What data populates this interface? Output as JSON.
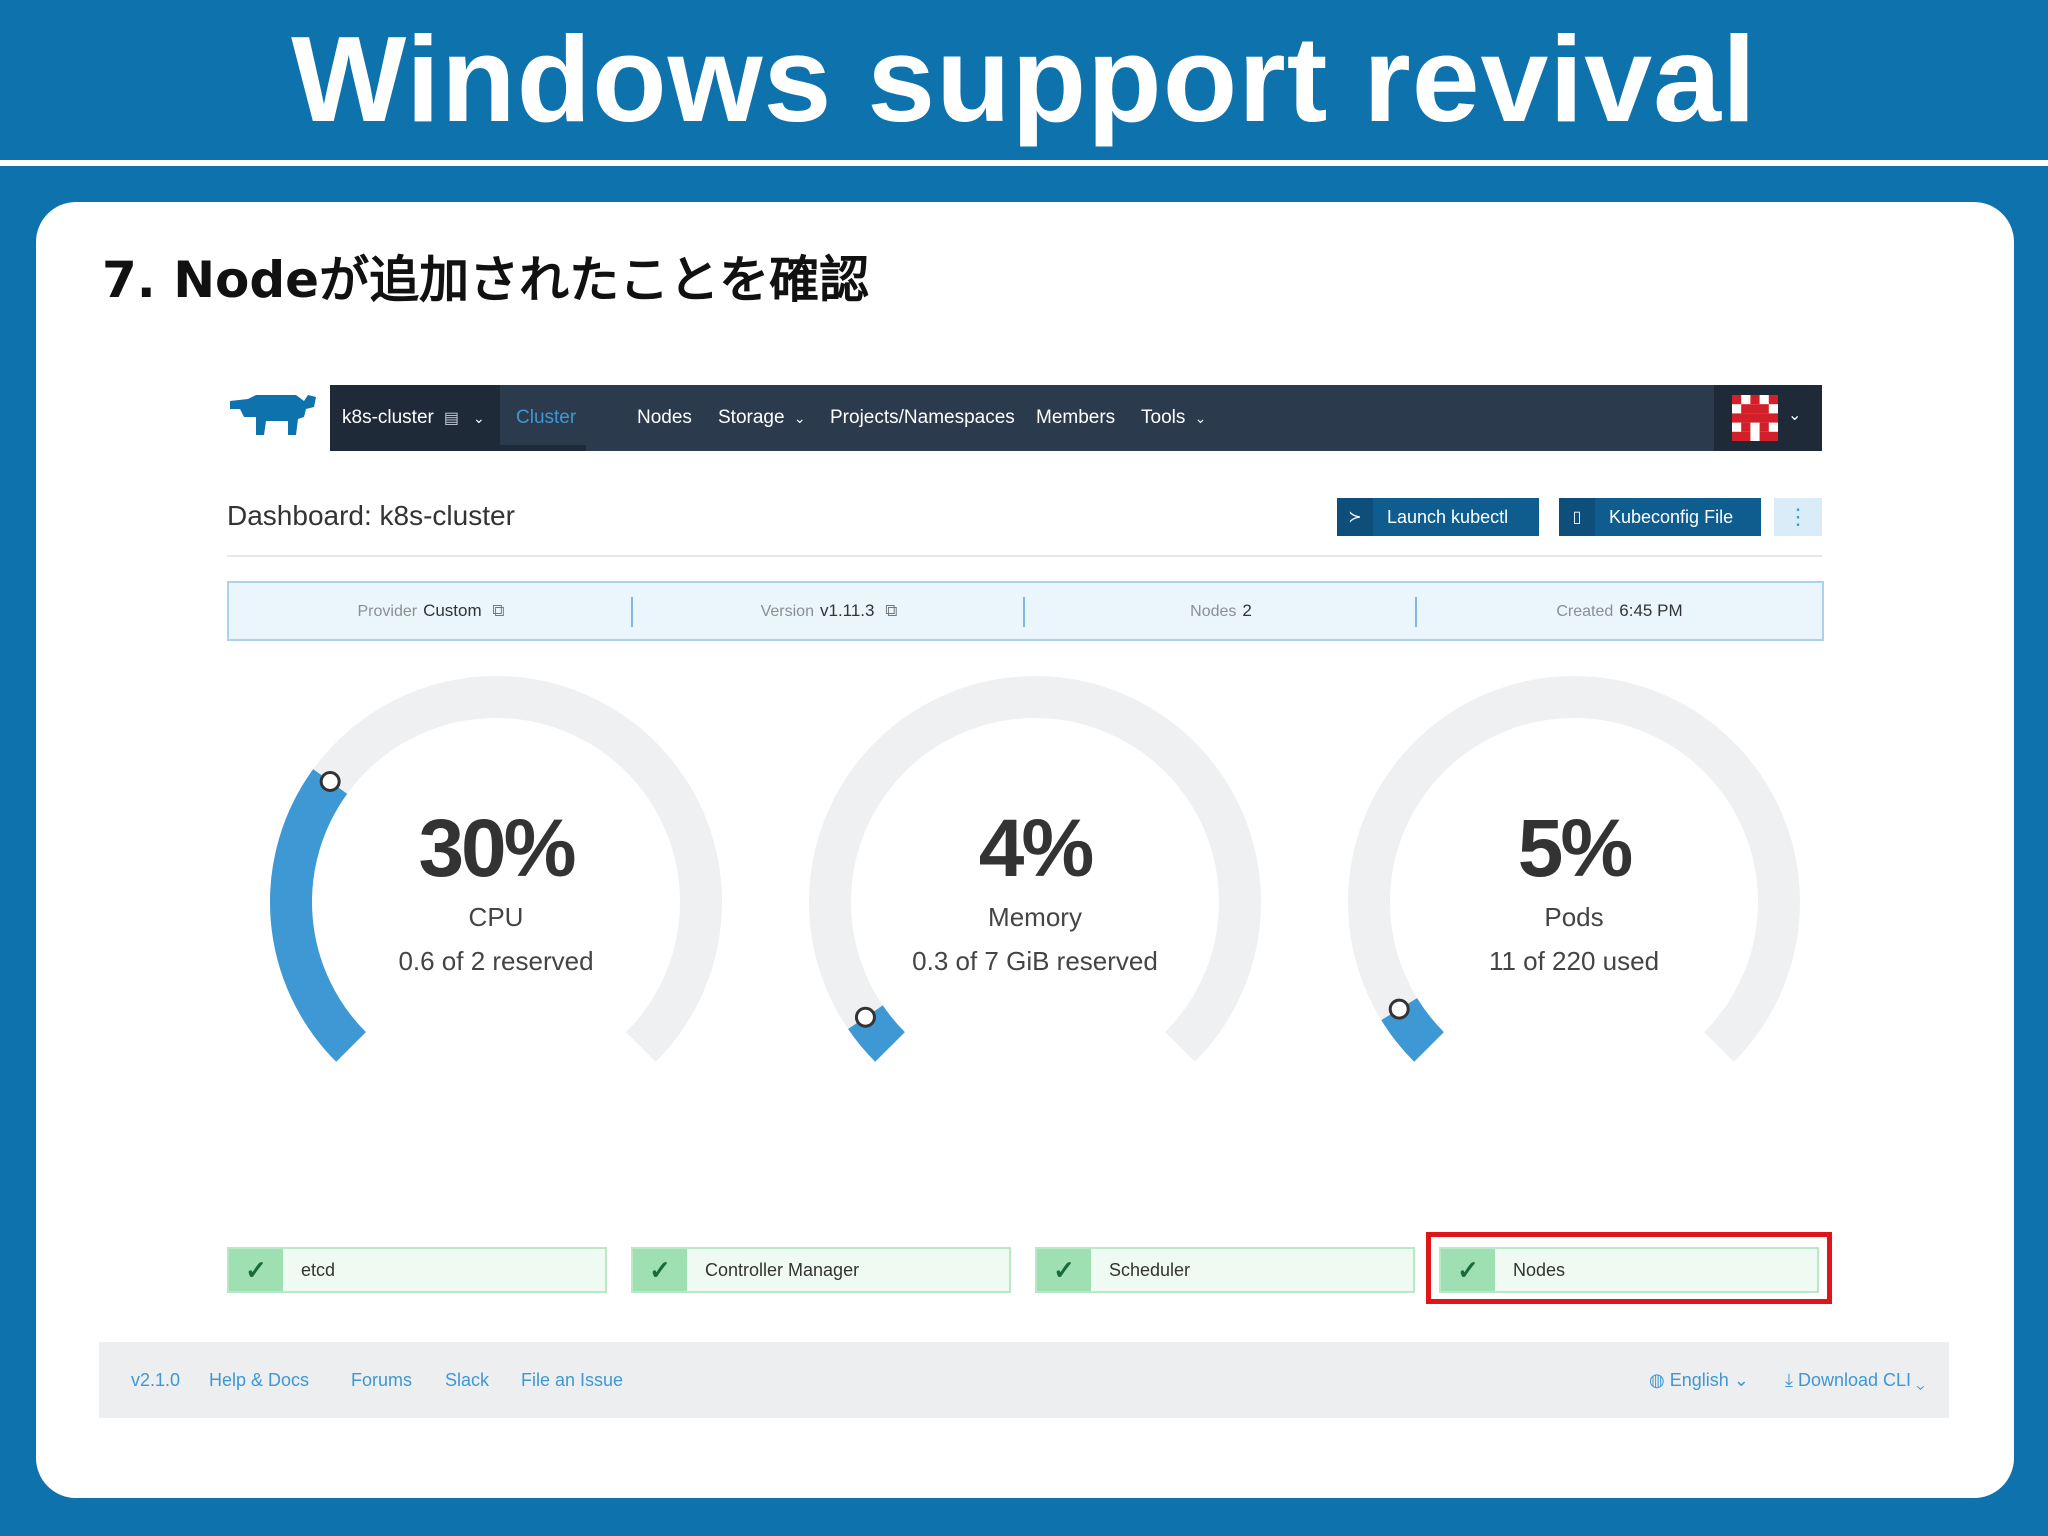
{
  "slide": {
    "title": "Windows support revival",
    "step_title": "7. Nodeが追加されたことを確認"
  },
  "rancher": {
    "logo_icon": "rancher-cow-icon",
    "cluster_selector": "k8s-cluster",
    "nav": {
      "cluster": "Cluster",
      "nodes": "Nodes",
      "storage": "Storage",
      "projects": "Projects/Namespaces",
      "members": "Members",
      "tools": "Tools"
    },
    "dashboard_title": "Dashboard: k8s-cluster",
    "buttons": {
      "launch_kubectl": "Launch kubectl",
      "kubeconfig": "Kubeconfig File"
    },
    "info": {
      "provider_label": "Provider",
      "provider_value": "Custom",
      "version_label": "Version",
      "version_value": "v1.11.3",
      "nodes_label": "Nodes",
      "nodes_value": "2",
      "created_label": "Created",
      "created_value": "6:45 PM"
    },
    "gauges": [
      {
        "value": "30%",
        "label": "CPU",
        "sub": "0.6  of  2  reserved",
        "fill": 0.3
      },
      {
        "value": "4%",
        "label": "Memory",
        "sub": "0.3  of  7  GiB  reserved",
        "fill": 0.04
      },
      {
        "value": "5%",
        "label": "Pods",
        "sub": "11  of  220  used",
        "fill": 0.05
      }
    ],
    "status": {
      "etcd": "etcd",
      "controller_manager": "Controller Manager",
      "scheduler": "Scheduler",
      "nodes": "Nodes"
    },
    "footer": {
      "version": "v2.1.0",
      "help": "Help  &  Docs",
      "forums": "Forums",
      "slack": "Slack",
      "file_issue": "File  an  Issue",
      "language": "English",
      "download_cli": "Download  CLI"
    },
    "colors": {
      "accent": "#3d98d3",
      "nav_bg": "#2c3a4d",
      "gauge_track": "#eef0f2",
      "gauge_fill": "#3d98d3",
      "highlight": "#e0151a"
    }
  }
}
